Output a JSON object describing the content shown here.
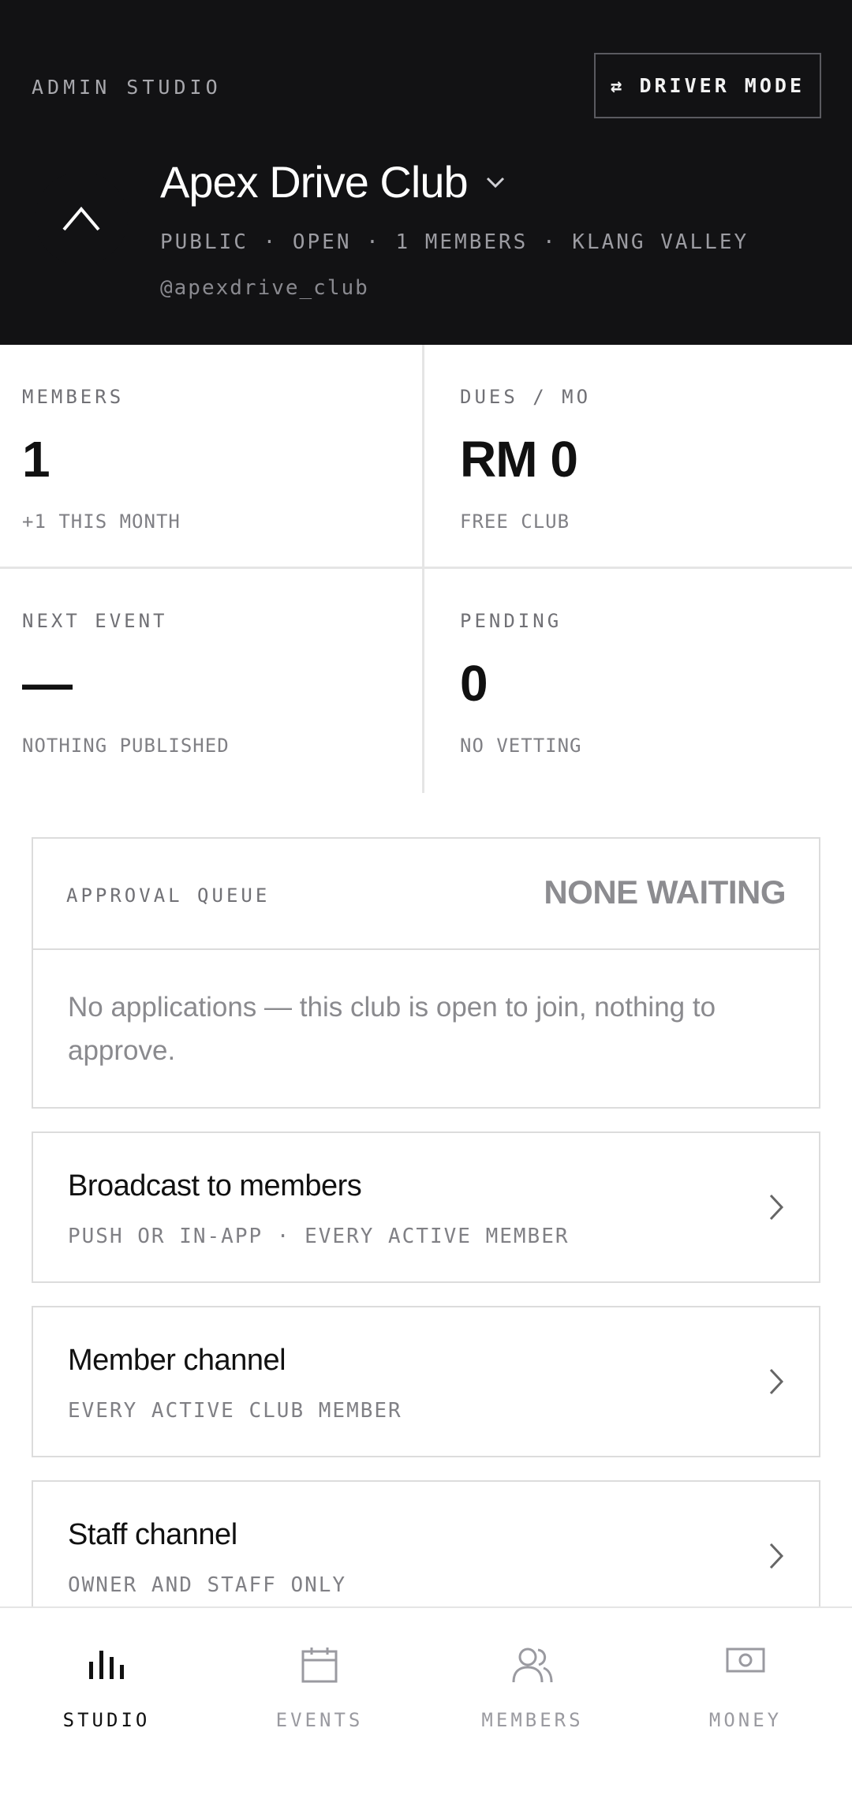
{
  "header": {
    "section_label": "ADMIN STUDIO",
    "driver_mode_label": "DRIVER MODE",
    "club_name": "Apex Drive Club",
    "club_meta": "PUBLIC · OPEN · 1 MEMBERS · KLANG VALLEY",
    "club_handle": "@apexdrive_club"
  },
  "stats": [
    {
      "label": "MEMBERS",
      "value": "1",
      "sub": "+1 THIS MONTH"
    },
    {
      "label": "DUES / MO",
      "value": "RM 0",
      "sub": "FREE CLUB"
    },
    {
      "label": "NEXT EVENT",
      "value": "—",
      "sub": "NOTHING PUBLISHED"
    },
    {
      "label": "PENDING",
      "value": "0",
      "sub": "NO VETTING"
    }
  ],
  "approval_queue": {
    "title": "APPROVAL QUEUE",
    "status": "NONE WAITING",
    "message": "No applications — this club is open to join, nothing to approve."
  },
  "cards": [
    {
      "title": "Broadcast to members",
      "sub": "PUSH OR IN-APP · EVERY ACTIVE MEMBER"
    },
    {
      "title": "Member channel",
      "sub": "EVERY ACTIVE CLUB MEMBER"
    },
    {
      "title": "Staff channel",
      "sub": "OWNER AND STAFF ONLY"
    }
  ],
  "nav": [
    {
      "label": "STUDIO",
      "icon": "bar-chart-icon",
      "active": true
    },
    {
      "label": "EVENTS",
      "icon": "calendar-icon",
      "active": false
    },
    {
      "label": "MEMBERS",
      "icon": "people-icon",
      "active": false
    },
    {
      "label": "MONEY",
      "icon": "banknote-icon",
      "active": false
    }
  ],
  "colors": {
    "header_bg": "#121214",
    "text_primary": "#111111",
    "text_muted": "#808085",
    "border": "#dcdcdc"
  }
}
